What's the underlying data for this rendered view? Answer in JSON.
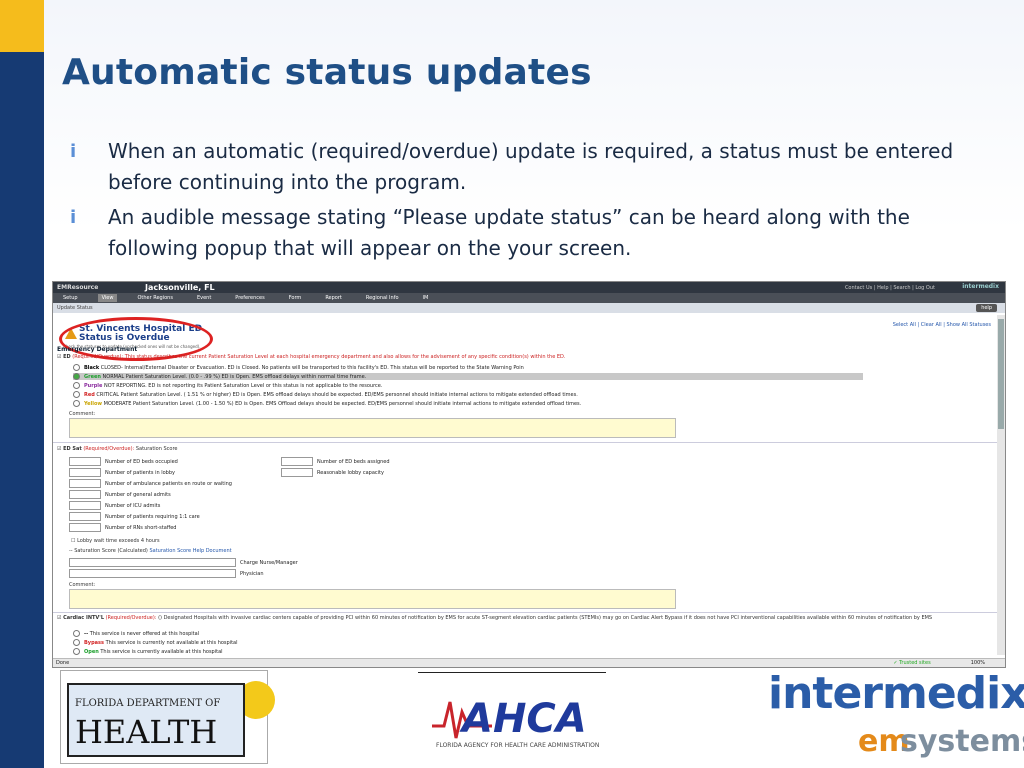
{
  "slide": {
    "title": "Automatic status updates",
    "bullets": [
      {
        "mark": "i",
        "text": "When an automatic (required/overdue) update is required, a status must be entered before continuing into the program."
      },
      {
        "mark": "i",
        "text": "An audible message stating “Please update status” can be heard along with the following popup that will appear on the your screen."
      }
    ]
  },
  "app": {
    "brand": "EMResource",
    "region": "Jacksonville, FL",
    "top_links": "Contact Us | Help | Search | Log Out",
    "logo": "intermedix",
    "nav": [
      "Setup",
      "View",
      "Other Regions",
      "Event",
      "Preferences",
      "Form",
      "Report",
      "Regional Info",
      "IM"
    ],
    "active_nav": "View",
    "subheader": "Update Status",
    "help_label": "help",
    "hospital_name": "St. Vincents Hospital ED",
    "status_overdue": "Status is Overdue",
    "hospital_note": "Check the statuses to update (unchecked ones will not be changed).",
    "right_links": "Select All | Clear All | Show All Statuses",
    "section_ed": "Emergency Department",
    "ed_label": "ED",
    "ed_description": "(Required/Overdue): This status describes the current Patient Saturation Level at each hospital emergency department and also allows for the advisement of any specific condition(s) within the ED.",
    "ed_options": [
      {
        "label": "Black",
        "color": "#000000",
        "text": "CLOSED- Internal/External Disaster or Evacuation. ED is Closed. No patients will be transported to this facility's ED. This status will be reported to the State Warning Poin"
      },
      {
        "label": "Green",
        "color": "#1a9e2a",
        "text": "NORMAL Patient Saturation Level. (0.0 - .99 %) ED is Open. EMS offload delays within normal time frame.",
        "selected": true
      },
      {
        "label": "Purple",
        "color": "#8a2a9e",
        "text": "NOT REPORTING. ED is not reporting its Patient Saturation Level or this status is not applicable to the resource."
      },
      {
        "label": "Red",
        "color": "#d22222",
        "text": "CRITICAL Patient Saturation Level. ( 1.51 % or higher) ED is Open. EMS offload delays should be expected. ED/EMS personnel should initiate internal actions to mitigate extended offload times."
      },
      {
        "label": "Yellow",
        "color": "#c9a400",
        "text": "MODERATE Patient Saturation Level. (1.00 - 1.50 %) ED is Open. EMS Offload delays should be expected. ED/EMS personnel should initiate internal actions to mitigate extended offload times."
      }
    ],
    "comment_label": "Comment:",
    "edsat_label": "ED Sat",
    "edsat_req": "(Required/Overdue):",
    "edsat_sub": "Saturation Score",
    "edsat_fields_left": [
      "Number of ED beds occupied",
      "Number of patients in lobby",
      "Number of ambulance patients en route or waiting",
      "Number of general admits",
      "Number of ICU admits",
      "Number of patients requiring 1:1 care",
      "Number of RNs short-staffed"
    ],
    "edsat_fields_right": [
      "Number of ED beds assigned",
      "Reasonable lobby capacity"
    ],
    "lobby_wait": "Lobby wait time exceeds 4 hours",
    "sat_score_calc": "-- Saturation Score (Calculated)",
    "sat_score_link": "Saturation Score Help Document",
    "charge_nurse": "Charge Nurse/Manager",
    "physician": "Physician",
    "cardiac_label": "Cardiac INTV'L",
    "cardiac_req": "(Required/Overdue):",
    "cardiac_text": "() Designated Hospitals with invasive cardiac centers capable of providing PCI within 60 minutes of notification by EMS for acute ST-segment elevation cardiac patients (STEMIs) may go on Cardiac Alert Bypass if it does not have PCI interventional capabilities available within 60 minutes of notification by EMS",
    "cardiac_options": [
      {
        "label": "--",
        "color": "#333333",
        "text": "This service is never offered at this hospital"
      },
      {
        "label": "Bypass",
        "color": "#d22222",
        "text": "This service is currently not available at this hospital"
      },
      {
        "label": "Open",
        "color": "#1a9e2a",
        "text": "This service is currently available at this hospital"
      }
    ],
    "status_done": "Done",
    "status_trusted": "Trusted sites",
    "status_zoom": "100%"
  },
  "logos": {
    "health_top": "FLORIDA DEPARTMENT OF",
    "health_main": "HEALTH",
    "ahca": "AHCA",
    "ahca_sub": "FLORIDA AGENCY FOR HEALTH CARE ADMINISTRATION",
    "imx_main": "intermedix",
    "imx_em": "em",
    "imx_sys": "systems"
  }
}
